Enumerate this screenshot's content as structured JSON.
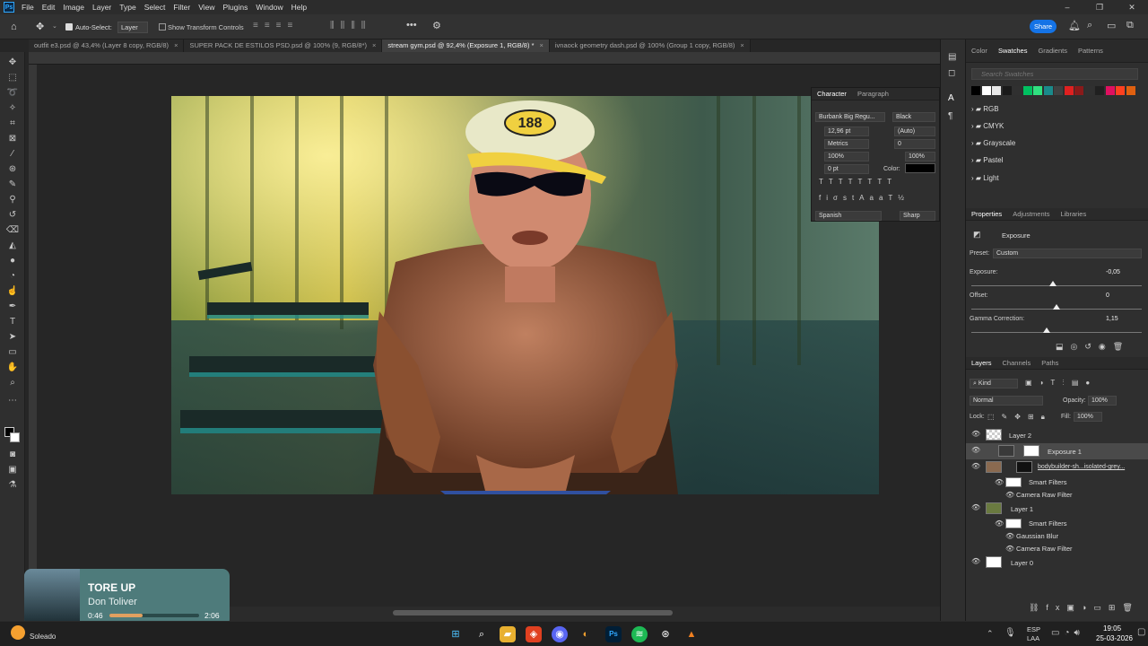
{
  "menu": {
    "items": [
      "File",
      "Edit",
      "Image",
      "Layer",
      "Type",
      "Select",
      "Filter",
      "View",
      "Plugins",
      "Window",
      "Help"
    ],
    "share": "Share"
  },
  "options": {
    "auto_select": "Auto-Select:",
    "layer_mode": "Layer",
    "show_transform": "Show Transform Controls"
  },
  "tabs": [
    {
      "label": "outfit e3.psd @ 43,4% (Layer 8 copy, RGB/8)",
      "active": false
    },
    {
      "label": "SUPER PACK DE ESTILOS PSD.psd @ 100% (9, RGB/8*)",
      "active": false
    },
    {
      "label": "stream gym.psd @ 92,4% (Exposure 1, RGB/8) *",
      "active": true
    },
    {
      "label": "ivnaock geometry dash.psd @ 100% (Group 1 copy, RGB/8)",
      "active": false
    }
  ],
  "character": {
    "tab1": "Character",
    "tab2": "Paragraph",
    "font": "Burbank Big Regu...",
    "style": "Black",
    "size": "12,96 pt",
    "leading": "(Auto)",
    "kerning": "Metrics",
    "tracking": "0",
    "vscale": "100%",
    "hscale": "100%",
    "baseline": "0 pt",
    "color_label": "Color:",
    "language": "Spanish",
    "aa": "Sharp"
  },
  "swatches": {
    "tabs": [
      "Color",
      "Swatches",
      "Gradients",
      "Patterns"
    ],
    "search_placeholder": "Search Swatches",
    "folders": [
      "RGB",
      "CMYK",
      "Grayscale",
      "Pastel",
      "Light"
    ],
    "colors": [
      "#000000",
      "#ffffff",
      "#e8e8e8",
      "#1a1a1a",
      "#303030",
      "#00c060",
      "#30e080",
      "#1a8a8a",
      "#404040",
      "#e02020",
      "#8a1a1a",
      "#303030",
      "#202020",
      "#e01060",
      "#ff4020",
      "#e06010"
    ]
  },
  "properties": {
    "tabs": [
      "Properties",
      "Adjustments",
      "Libraries"
    ],
    "title": "Exposure",
    "preset_label": "Preset:",
    "preset": "Custom",
    "exposure_label": "Exposure:",
    "exposure": "-0,05",
    "exposure_pos": 0.48,
    "offset_label": "Offset:",
    "offset": "0",
    "offset_pos": 0.5,
    "gamma_label": "Gamma Correction:",
    "gamma": "1,15",
    "gamma_pos": 0.44
  },
  "layers": {
    "tabs": [
      "Layers",
      "Channels",
      "Paths"
    ],
    "kind": "Kind",
    "blend": "Normal",
    "opacity_label": "Opacity:",
    "opacity": "100%",
    "lock_label": "Lock:",
    "fill_label": "Fill:",
    "fill": "100%",
    "rows": [
      {
        "name": "Layer 2"
      },
      {
        "name": "Exposure 1"
      },
      {
        "name": "bodybuilder-sh...isolated-grey..."
      },
      {
        "name": "Smart Filters"
      },
      {
        "name": "Camera Raw Filter"
      },
      {
        "name": "Layer 1"
      },
      {
        "name": "Smart Filters"
      },
      {
        "name": "Gaussian Blur"
      },
      {
        "name": "Camera Raw Filter"
      },
      {
        "name": "Layer 0"
      }
    ]
  },
  "media": {
    "title": "TORE UP",
    "artist": "Don Toliver",
    "elapsed": "0:46",
    "total": "2:06",
    "progress": 0.37
  },
  "taskbar": {
    "weather": "Soleado",
    "lang1": "ESP",
    "lang2": "LAA",
    "time": "19:05",
    "date": "25-03-2026"
  }
}
